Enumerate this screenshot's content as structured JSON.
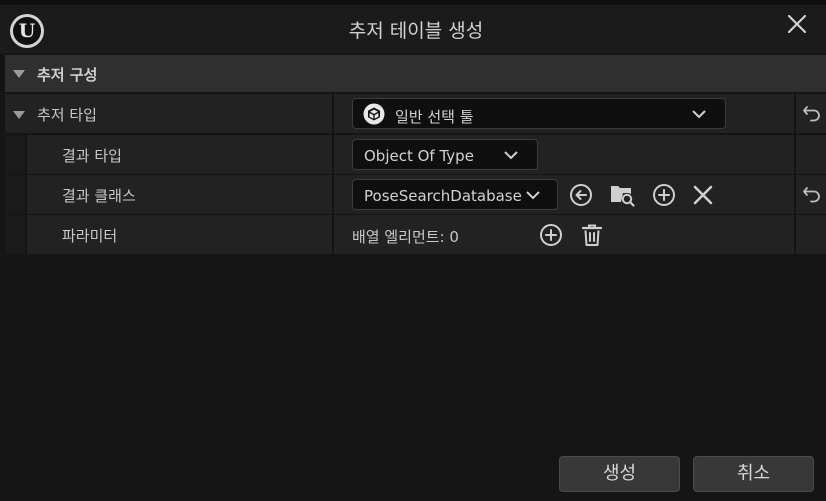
{
  "window": {
    "title": "추저 테이블 생성",
    "logo_icon": "unreal-logo-icon",
    "close_icon": "close-icon"
  },
  "category": {
    "label": "추저 구성"
  },
  "rows": {
    "chooser_type": {
      "label": "추저 타입",
      "value": "일반 선택 툴",
      "value_icon": "cube-icon"
    },
    "result_type": {
      "label": "결과 타입",
      "value": "Object Of Type"
    },
    "result_class": {
      "label": "결과 클래스",
      "value": "PoseSearchDatabase",
      "icons": [
        "browse-back-icon",
        "find-in-browser-icon",
        "add-icon",
        "clear-icon"
      ]
    },
    "parameters": {
      "label": "파라미터",
      "value": "배열 엘리먼트: 0",
      "icons": [
        "add-icon",
        "trash-icon"
      ]
    }
  },
  "footer": {
    "create_label": "생성",
    "cancel_label": "취소"
  },
  "colors": {
    "background": "#151515",
    "row": "#222222",
    "category": "#2f2f2f",
    "combo": "#0f0f0f"
  }
}
